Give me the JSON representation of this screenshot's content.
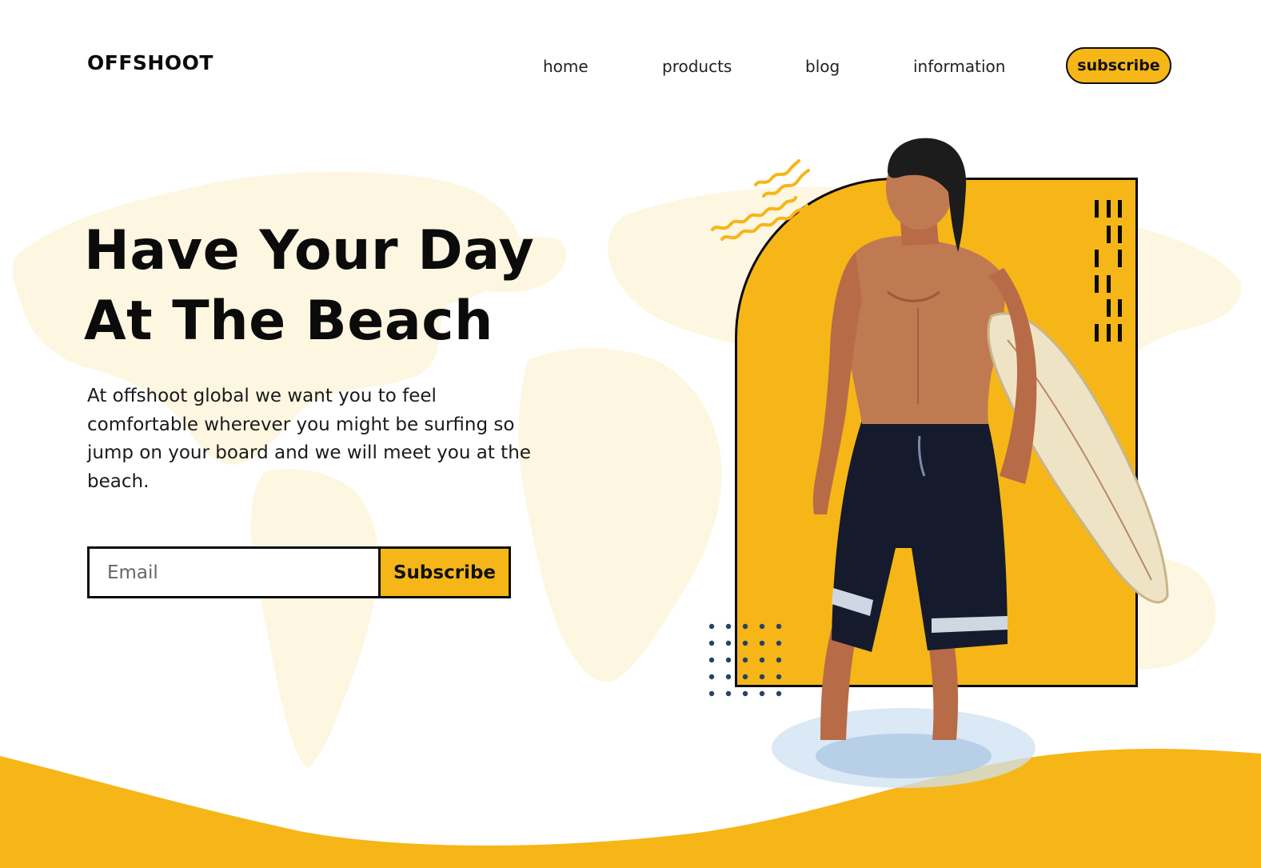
{
  "brand": {
    "name": "OFFSHOOT"
  },
  "nav": {
    "items": [
      {
        "label": "home"
      },
      {
        "label": "products"
      },
      {
        "label": "blog"
      },
      {
        "label": "information"
      }
    ],
    "subscribe_label": "subscribe"
  },
  "hero": {
    "title_line1": "Have Your Day",
    "title_line2": "At The Beach",
    "description": "At offshoot global we want you to feel comfortable wherever you might be surfing so jump on your board and we will meet you at the beach.",
    "email_placeholder": "Email",
    "subscribe_button": "Subscribe"
  },
  "icons": {
    "squiggle": "wavy-lines-icon",
    "tally": "tally-marks-icon",
    "dots": "dot-grid-icon",
    "map": "world-map-background",
    "surfer": "surfer-with-board-image"
  },
  "colors": {
    "accent": "#f6b617",
    "text": "#0b0b0b",
    "dots": "#26416b",
    "map": "#fdf6e0"
  }
}
